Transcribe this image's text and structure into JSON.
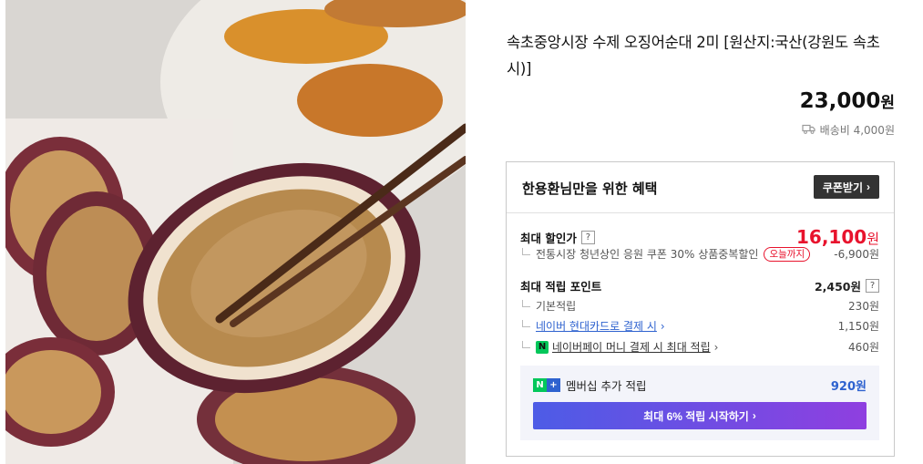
{
  "product": {
    "title": "속초중앙시장 수제 오징어순대 2미 [원산지:국산(강원도 속초시)]",
    "price": "23,000",
    "currency": "원",
    "shipping": "배송비 4,000원"
  },
  "benefit": {
    "heading": "한용환님만을 위한 혜택",
    "coupon_button": "쿠폰받기",
    "max_discount": {
      "label": "최대 할인가",
      "price": "16,100",
      "currency": "원",
      "detail": "전통시장 청년상인 응원 쿠폰 30% 상품중복할인",
      "badge": "오늘까지",
      "amount": "-6,900원"
    },
    "points": {
      "label": "최대 적립 포인트",
      "total": "2,450원",
      "items": [
        {
          "label": "기본적립",
          "value": "230원"
        },
        {
          "label": "네이버 현대카드로 결제 시",
          "value": "1,150원"
        },
        {
          "label": "네이버페이 머니 결제 시 최대 적립",
          "value": "460원"
        }
      ]
    },
    "membership": {
      "label": "멤버십 추가 적립",
      "value": "920원",
      "cta": "최대 6% 적립 시작하기"
    }
  },
  "icons": {
    "help": "?",
    "chevron": "›",
    "truck": "truck-icon",
    "npay": "N",
    "nplus_n": "N",
    "nplus_plus": "+"
  },
  "colors": {
    "discount_red": "#e8132d",
    "link_blue": "#2e62cf",
    "npay_green": "#03c75a",
    "cta_start": "#4d5ce6",
    "cta_end": "#8f3fe0"
  }
}
